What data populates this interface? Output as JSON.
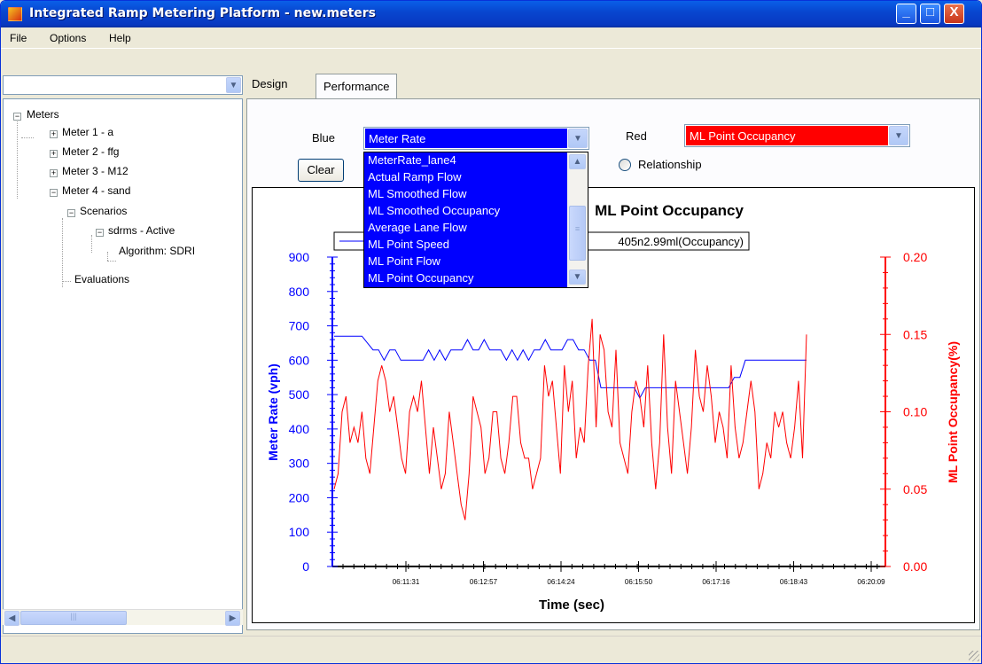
{
  "window": {
    "title": "Integrated Ramp Metering Platform - new.meters",
    "minimize": "_",
    "maximize": "□",
    "close": "X"
  },
  "menu": [
    "File",
    "Options",
    "Help"
  ],
  "left_combo": {
    "value": "",
    "arrow": "⌄"
  },
  "tree": {
    "root": "Meters",
    "meters": [
      "Meter 1 - a",
      "Meter 2 - ffg",
      "Meter 3 - M12",
      "Meter 4 - sand"
    ],
    "scenarios": "Scenarios",
    "scenario": "sdrms - Active",
    "algorithm": "Algorithm: SDRI",
    "evaluations": "Evaluations"
  },
  "tabs": {
    "design": "Design",
    "performance": "Performance"
  },
  "controls": {
    "blue_label": "Blue",
    "blue_value": "Meter Rate",
    "red_label": "Red",
    "red_value": "ML Point Occupancy",
    "clear": "Clear",
    "relationship": "Relationship",
    "dropdown_items": [
      "MeterRate_lane4",
      "Actual Ramp Flow",
      "ML Smoothed Flow",
      "ML Smoothed Occupancy",
      "Average Lane Flow",
      "ML Point Speed",
      "ML Point Flow",
      "ML Point Occupancy"
    ]
  },
  "colors": {
    "blue": "#0000ff",
    "red": "#ff0000",
    "title_bar": "#0847d0"
  },
  "chart_data": {
    "type": "line",
    "title": "ML Point Occupancy",
    "legend_fragment": "405n2.99ml(Occupancy)",
    "xlabel": "Time (sec)",
    "ylabel_left": "Meter Rate (vph)",
    "ylabel_right": "ML Point Occupancy(%)",
    "x_ticks": [
      "06:11:31",
      "06:12:57",
      "06:14:24",
      "06:15:50",
      "06:17:16",
      "06:18:43",
      "06:20:09"
    ],
    "y_left_ticks": [
      "0",
      "100",
      "200",
      "300",
      "400",
      "500",
      "600",
      "700",
      "800",
      "900"
    ],
    "y_right_ticks": [
      "0.00",
      "0.05",
      "0.10",
      "0.15",
      "0.20"
    ],
    "ylim_left": [
      0,
      900
    ],
    "ylim_right": [
      0,
      0.2
    ],
    "series": [
      {
        "color": "#0000ff",
        "axis": "left",
        "values": [
          670,
          670,
          670,
          670,
          670,
          670,
          650,
          630,
          630,
          600,
          630,
          630,
          600,
          600,
          600,
          600,
          600,
          630,
          600,
          630,
          600,
          630,
          630,
          630,
          660,
          630,
          630,
          660,
          630,
          630,
          630,
          600,
          630,
          600,
          630,
          600,
          630,
          630,
          660,
          630,
          630,
          630,
          660,
          660,
          630,
          630,
          600,
          600,
          520,
          520,
          520,
          520,
          520,
          520,
          520,
          490,
          520,
          520,
          520,
          520,
          520,
          520,
          520,
          520,
          520,
          520,
          520,
          520,
          520,
          520,
          520,
          520,
          550,
          550,
          600,
          600,
          600,
          600,
          600,
          600,
          600,
          600,
          600,
          600,
          600,
          600
        ]
      },
      {
        "color": "#ff0000",
        "axis": "right",
        "values": [
          0.05,
          0.06,
          0.1,
          0.11,
          0.08,
          0.09,
          0.08,
          0.1,
          0.07,
          0.06,
          0.09,
          0.12,
          0.13,
          0.12,
          0.1,
          0.11,
          0.09,
          0.07,
          0.06,
          0.1,
          0.11,
          0.1,
          0.12,
          0.09,
          0.06,
          0.09,
          0.07,
          0.05,
          0.06,
          0.1,
          0.08,
          0.06,
          0.04,
          0.03,
          0.06,
          0.11,
          0.1,
          0.09,
          0.06,
          0.07,
          0.1,
          0.1,
          0.07,
          0.06,
          0.08,
          0.11,
          0.11,
          0.08,
          0.07,
          0.07,
          0.05,
          0.06,
          0.07,
          0.13,
          0.11,
          0.12,
          0.09,
          0.06,
          0.13,
          0.1,
          0.12,
          0.07,
          0.09,
          0.08,
          0.13,
          0.16,
          0.09,
          0.15,
          0.14,
          0.1,
          0.09,
          0.14,
          0.08,
          0.07,
          0.06,
          0.1,
          0.12,
          0.11,
          0.09,
          0.13,
          0.08,
          0.05,
          0.08,
          0.15,
          0.09,
          0.06,
          0.12,
          0.1,
          0.08,
          0.06,
          0.09,
          0.14,
          0.11,
          0.1,
          0.13,
          0.11,
          0.08,
          0.1,
          0.09,
          0.07,
          0.13,
          0.09,
          0.07,
          0.08,
          0.1,
          0.12,
          0.1,
          0.05,
          0.06,
          0.08,
          0.07,
          0.1,
          0.09,
          0.1,
          0.08,
          0.07,
          0.09,
          0.12,
          0.07,
          0.15
        ]
      }
    ]
  }
}
